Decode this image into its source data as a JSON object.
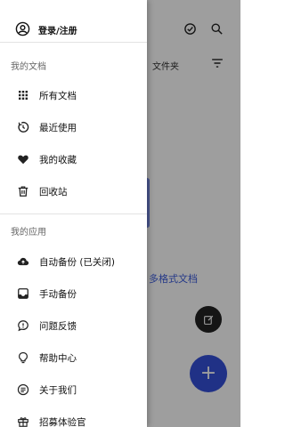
{
  "app": {
    "folder_tab_label": "文件夹",
    "partial_link_text": "多格式文档",
    "fab_add_label": "+"
  },
  "drawer": {
    "account_label": "登录/注册",
    "section_documents": {
      "title": "我的文档",
      "items": [
        {
          "label": "所有文档",
          "icon": "grid-icon"
        },
        {
          "label": "最近使用",
          "icon": "history-icon"
        },
        {
          "label": "我的收藏",
          "icon": "heart-icon"
        },
        {
          "label": "回收站",
          "icon": "trash-icon"
        }
      ]
    },
    "section_apps": {
      "title": "我的应用",
      "items": [
        {
          "label": "自动备份 (已关闭)",
          "icon": "cloud-upload-icon"
        },
        {
          "label": "手动备份",
          "icon": "inbox-icon"
        },
        {
          "label": "问题反馈",
          "icon": "feedback-icon"
        },
        {
          "label": "帮助中心",
          "icon": "help-icon"
        },
        {
          "label": "关于我们",
          "icon": "about-icon"
        },
        {
          "label": "招募体验官",
          "icon": "gift-icon"
        }
      ]
    }
  },
  "colors": {
    "accent_blue": "#3550d8",
    "scrim": "rgba(0,0,0,0.38)"
  }
}
